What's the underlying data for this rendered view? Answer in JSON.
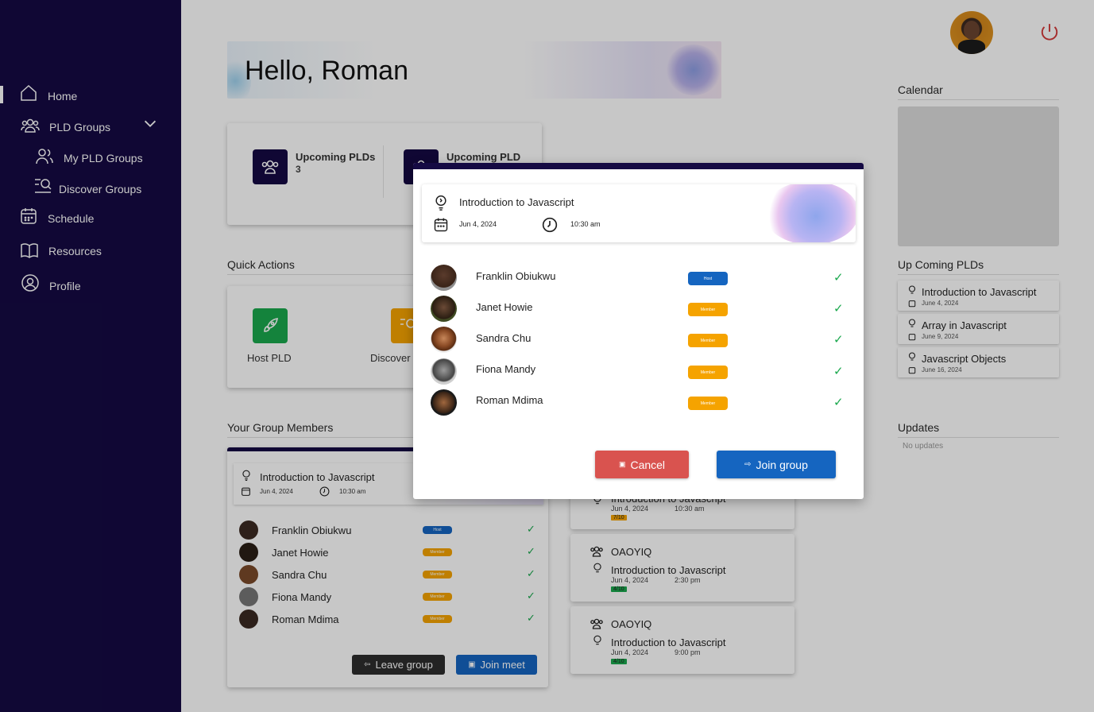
{
  "sidebar": {
    "items": [
      {
        "label": "Home",
        "icon": "home-icon"
      },
      {
        "label": "PLD Groups",
        "icon": "users-icon"
      },
      {
        "label": "My PLD Groups",
        "icon": "users-icon"
      },
      {
        "label": "Discover Groups",
        "icon": "search-list-icon"
      },
      {
        "label": "Schedule",
        "icon": "calendar-icon"
      },
      {
        "label": "Resources",
        "icon": "book-icon"
      },
      {
        "label": "Profile",
        "icon": "user-circle-icon"
      }
    ]
  },
  "greeting": "Hello, Roman",
  "stats": {
    "upcoming_label": "Upcoming PLDs",
    "upcoming_count": "3",
    "upcoming2_label": "Upcoming PLD"
  },
  "quick_actions": {
    "title": "Quick Actions",
    "host_label": "Host PLD",
    "discover_label": "Discover"
  },
  "group_members": {
    "title": "Your Group Members",
    "pld_title": "Introduction to Javascript",
    "date": "Jun 4, 2024",
    "time": "10:30 am",
    "members": [
      {
        "name": "Franklin Obiukwu",
        "role": "Host"
      },
      {
        "name": "Janet Howie",
        "role": "Member"
      },
      {
        "name": "Sandra Chu",
        "role": "Member"
      },
      {
        "name": "Fiona Mandy",
        "role": "Member"
      },
      {
        "name": "Roman Mdima",
        "role": "Member"
      }
    ],
    "leave_label": "Leave group",
    "join_meet_label": "Join meet"
  },
  "group_cards": [
    {
      "group": "",
      "title": "Introduction to Javascript",
      "date": "Jun 4, 2024",
      "time": "10:30 am",
      "count": "7/10"
    },
    {
      "group": "OAOYIQ",
      "title": "Introduction to Javascript",
      "date": "Jun 4, 2024",
      "time": "2:30 pm",
      "count": "4/10"
    },
    {
      "group": "OAOYIQ",
      "title": "Introduction to Javascript",
      "date": "Jun 4, 2024",
      "time": "9:00 pm",
      "count": "4/10"
    }
  ],
  "right": {
    "calendar_title": "Calendar",
    "upcoming_title": "Up Coming PLDs",
    "upcoming": [
      {
        "title": "Introduction to Javascript",
        "date": "June 4, 2024"
      },
      {
        "title": "Array in Javascript",
        "date": "June 9, 2024"
      },
      {
        "title": "Javascript Objects",
        "date": "June 16, 2024"
      }
    ],
    "updates_title": "Updates",
    "updates_empty": "No updates"
  },
  "modal": {
    "title": "Introduction to Javascript",
    "date": "Jun 4, 2024",
    "time": "10:30 am",
    "members": [
      {
        "name": "Franklin Obiukwu",
        "role": "Host"
      },
      {
        "name": "Janet Howie",
        "role": "Member"
      },
      {
        "name": "Sandra Chu",
        "role": "Member"
      },
      {
        "name": "Fiona Mandy",
        "role": "Member"
      },
      {
        "name": "Roman Mdima",
        "role": "Member"
      }
    ],
    "cancel_label": "Cancel",
    "join_label": "Join group"
  },
  "colors": {
    "sidebar": "#150a43",
    "host_badge": "#1565c0",
    "member_badge": "#f5a300",
    "cancel": "#d9534f",
    "join": "#1565c0",
    "green_action": "#1aa84d",
    "check": "#1aa84d"
  }
}
